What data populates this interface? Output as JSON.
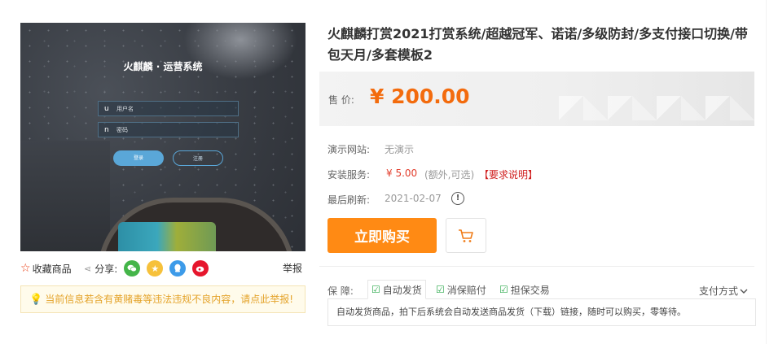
{
  "preview": {
    "title": "火麒麟 · 运营系统",
    "username_icon": "u",
    "username_placeholder": "用户名",
    "password_icon": "n",
    "password_placeholder": "密码",
    "login_label": "登录",
    "register_label": "注册"
  },
  "actions": {
    "favorite_label": "收藏商品",
    "share_label": "分享:",
    "share_platforms": [
      "wechat",
      "qzone",
      "qq",
      "weibo"
    ],
    "report_label": "举报"
  },
  "warning": {
    "text": "当前信息若含有黄赌毒等违法违规不良内容，请点此举报!"
  },
  "product": {
    "title": "火麒麟打赏2021打赏系统/超越冠军、诺诺/多级防封/多支付接口切换/带包天月/多套模板2",
    "price_label": "售  价:",
    "price_value": "¥ 200.00",
    "demo_label": "演示网站:",
    "demo_value": "无演示",
    "install_label": "安装服务:",
    "install_price": "¥ 5.00",
    "install_note": "(额外,可选)",
    "install_link": "【要求说明】",
    "refresh_label": "最后刷新:",
    "refresh_value": "2021-02-07",
    "buy_label": "立即购买"
  },
  "guarantee": {
    "label": "保    障:",
    "tabs": [
      "自动发货",
      "消保赔付",
      "担保交易"
    ],
    "pay_methods_label": "支付方式",
    "description": "自动发货商品，拍下后系统会自动发送商品发货（下载）链接，随时可以购买，零等待。"
  },
  "colors": {
    "price": "#f36b0d",
    "buy_button": "#ff8a14",
    "warning_text": "#e4a32a",
    "guarantee_check": "#2aa84a",
    "install_link": "#d02020"
  }
}
